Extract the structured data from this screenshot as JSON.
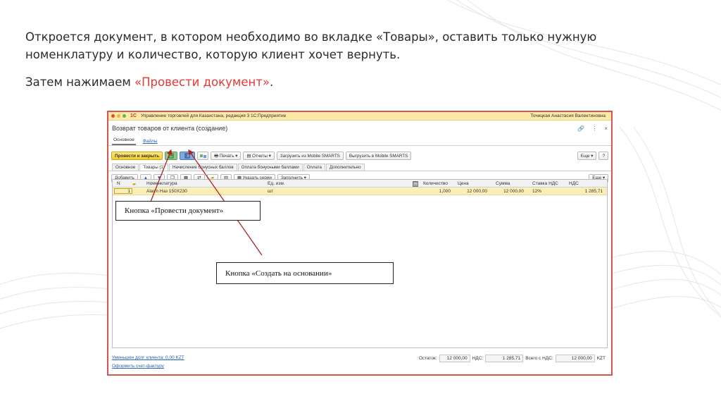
{
  "slide": {
    "para1": "Откроется документ, в котором необходимо во вкладке «Товары», оставить только нужную номенклатуру и количество, которую клиент хочет вернуть.",
    "para2_prefix": "Затем нажимаем ",
    "para2_accent": "«Провести документ»",
    "para2_suffix": "."
  },
  "window": {
    "app_logo": "1С",
    "title": "Управление торговлей для Казахстана, редакция 3 1С:Предприятие",
    "user": "Точицкая Анастасия Валентиновна",
    "doc_title": "Возврат товаров от клиента (создание)",
    "top_tabs": [
      "Основное",
      "Файлы"
    ],
    "toolbar": {
      "post_close": "Провести и закрыть",
      "print": "Печать",
      "reports": "Отчеты",
      "load_mobile": "Загрузить из Mobile SMARTS",
      "unload_mobile": "Выгрузить в Mobile SMARTS",
      "more": "Еще",
      "help": "?"
    },
    "sub_tabs": [
      "Основное",
      "Товары (1)",
      "Начисление бонусных баллов",
      "Оплата бонусными баллами",
      "Оплата",
      "Дополнительно"
    ],
    "table_toolbar": {
      "add": "Добавить",
      "series": "Указать серии",
      "fill": "Заполнить",
      "more": "Еще"
    },
    "columns": {
      "n": "N",
      "nomenclature": "Номенклатура",
      "unit": "Ед. изм.",
      "qty": "Количество",
      "price": "Цена",
      "sum": "Сумма",
      "vat_rate": "Ставка НДС",
      "vat": "НДС"
    },
    "rows": [
      {
        "n": "1",
        "nomenclature": "Alarm Наз 150Х230",
        "unit": "шт",
        "qty": "1,000",
        "price": "12 000,00",
        "sum": "12 000,00",
        "vat_rate": "12%",
        "vat": "1 285,71"
      }
    ],
    "footer": {
      "debt_link": "Уменьшен долг клиента: 0,00 KZT",
      "invoice_link": "Оформить счет-фактуру",
      "balance_label": "Остаток:",
      "balance": "12 000,00",
      "vat_label": "НДС:",
      "vat": "1 285,71",
      "total_label": "Всего с НДС:",
      "total": "12 000,00",
      "currency": "KZT"
    }
  },
  "callouts": {
    "post": "Кнопка «Провести документ»",
    "create_based": "Кнопка «Создать на основании»"
  },
  "colors": {
    "accent": "#e53935",
    "window_border": "#d9534f",
    "titlebar": "#fbe9a8",
    "row_highlight": "#fbefb8",
    "arrow": "#b22222"
  }
}
